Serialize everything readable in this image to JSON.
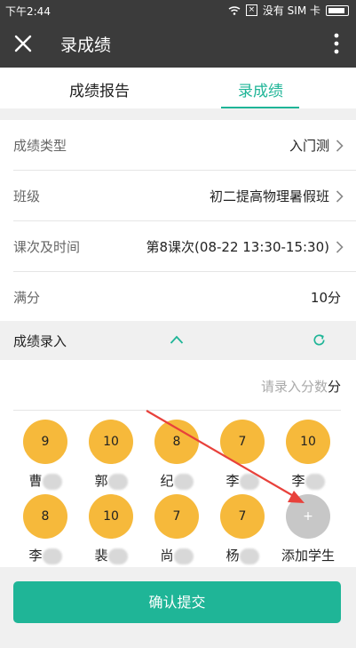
{
  "status_bar": {
    "time": "下午2:44",
    "carrier": "没有 SIM 卡",
    "sim_box": "×"
  },
  "toolbar": {
    "title": "录成绩"
  },
  "tabs": [
    {
      "label": "成绩报告",
      "active": false
    },
    {
      "label": "录成绩",
      "active": true
    }
  ],
  "form": {
    "rows": [
      {
        "label": "成绩类型",
        "value": "入门测"
      },
      {
        "label": "班级",
        "value": "初二提高物理暑假班"
      },
      {
        "label": "课次及时间",
        "value": "第8课次(08-22 13:30-15:30)"
      },
      {
        "label": "满分",
        "value": "10分"
      }
    ]
  },
  "score_entry": {
    "header": "成绩录入",
    "placeholder": "请录入分数",
    "unit": "分"
  },
  "students": [
    {
      "score": "9",
      "name_visible": "曹"
    },
    {
      "score": "10",
      "name_visible": "郭"
    },
    {
      "score": "8",
      "name_visible": "纪"
    },
    {
      "score": "7",
      "name_visible": "李"
    },
    {
      "score": "10",
      "name_visible": "李"
    },
    {
      "score": "8",
      "name_visible": "李"
    },
    {
      "score": "10",
      "name_visible": "裴"
    },
    {
      "score": "7",
      "name_visible": "尚"
    },
    {
      "score": "7",
      "name_visible": "杨"
    }
  ],
  "add_student": {
    "icon": "+",
    "label": "添加学生"
  },
  "submit": {
    "label": "确认提交"
  },
  "colors": {
    "accent": "#1fb597",
    "score_bubble": "#f6b93b",
    "toolbar": "#3b3b3b",
    "annotation_arrow": "#e8413b"
  }
}
